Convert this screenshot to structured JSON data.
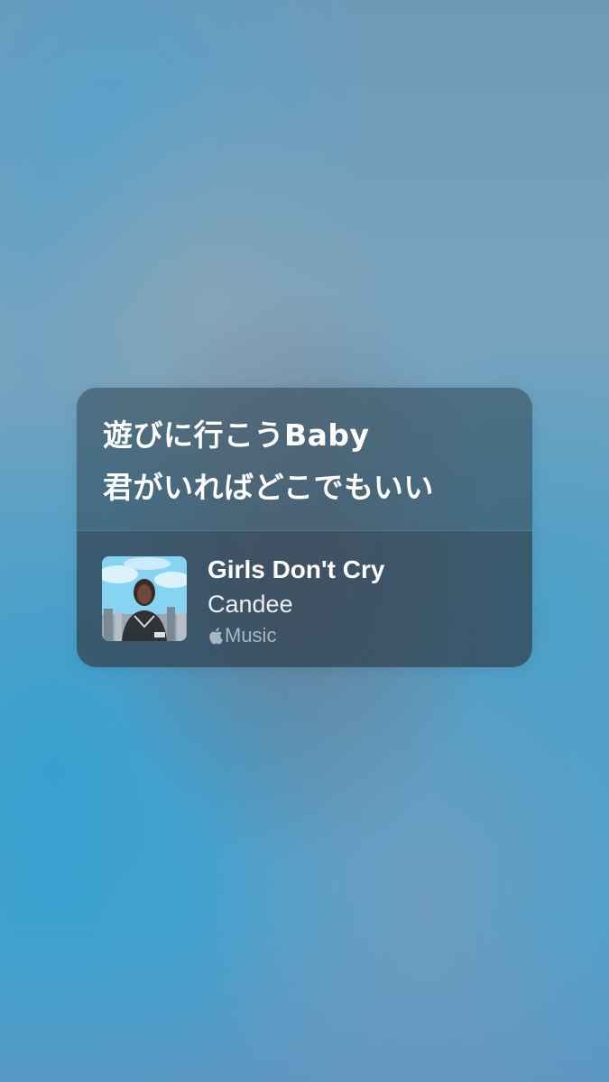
{
  "lyrics": {
    "lines": [
      "遊びに行こうBaby",
      "君がいればどこでもいい"
    ]
  },
  "track": {
    "title": "Girls Don't Cry",
    "artist": "Candee",
    "service_label": "Music",
    "service_icon": "apple-logo-icon",
    "artwork_icon": "album-artwork"
  },
  "colors": {
    "card_background": "#374e5c",
    "text_primary": "#ffffff",
    "text_secondary": "#e9eef2",
    "text_tertiary": "#a9b8c2"
  }
}
